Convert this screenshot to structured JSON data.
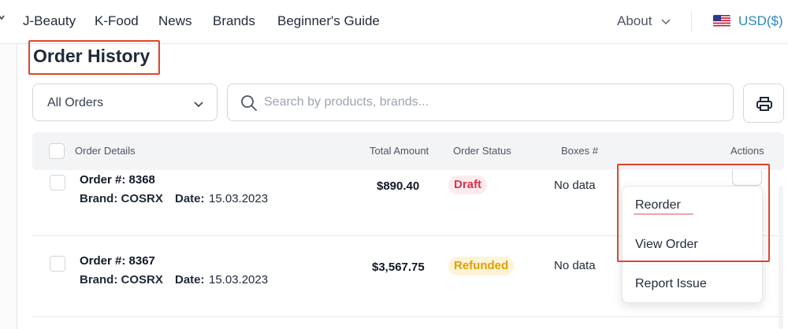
{
  "nav": {
    "items": [
      "J-Beauty",
      "K-Food",
      "News",
      "Brands",
      "Beginner's Guide"
    ],
    "about": "About",
    "currency": "USD($)"
  },
  "page": {
    "title": "Order History"
  },
  "filters": {
    "status_value": "All Orders",
    "search_placeholder": "Search by products, brands..."
  },
  "table": {
    "headers": {
      "details": "Order Details",
      "amount": "Total Amount",
      "status": "Order Status",
      "boxes": "Boxes #",
      "actions": "Actions"
    },
    "labels": {
      "brand": "Brand: ",
      "date": "Date:"
    },
    "rows": [
      {
        "order": "Order #: 8368",
        "brand": "Brand: COSRX",
        "date_label": "Date:",
        "date": "15.03.2023",
        "amount": "$890.40",
        "status": "Draft",
        "boxes": "No data"
      },
      {
        "order": "Order #: 8367",
        "brand": "Brand: COSRX",
        "date_label": "Date:",
        "date": "15.03.2023",
        "amount": "$3,567.75",
        "status": "Refunded",
        "boxes": "No data"
      }
    ]
  },
  "menu": {
    "items": [
      "Reorder",
      "View Order",
      "Report Issue"
    ]
  },
  "colors": {
    "accent": "#2e86c1",
    "highlight": "#e0442b",
    "draft": "#e0314b",
    "refunded": "#e0a000"
  }
}
